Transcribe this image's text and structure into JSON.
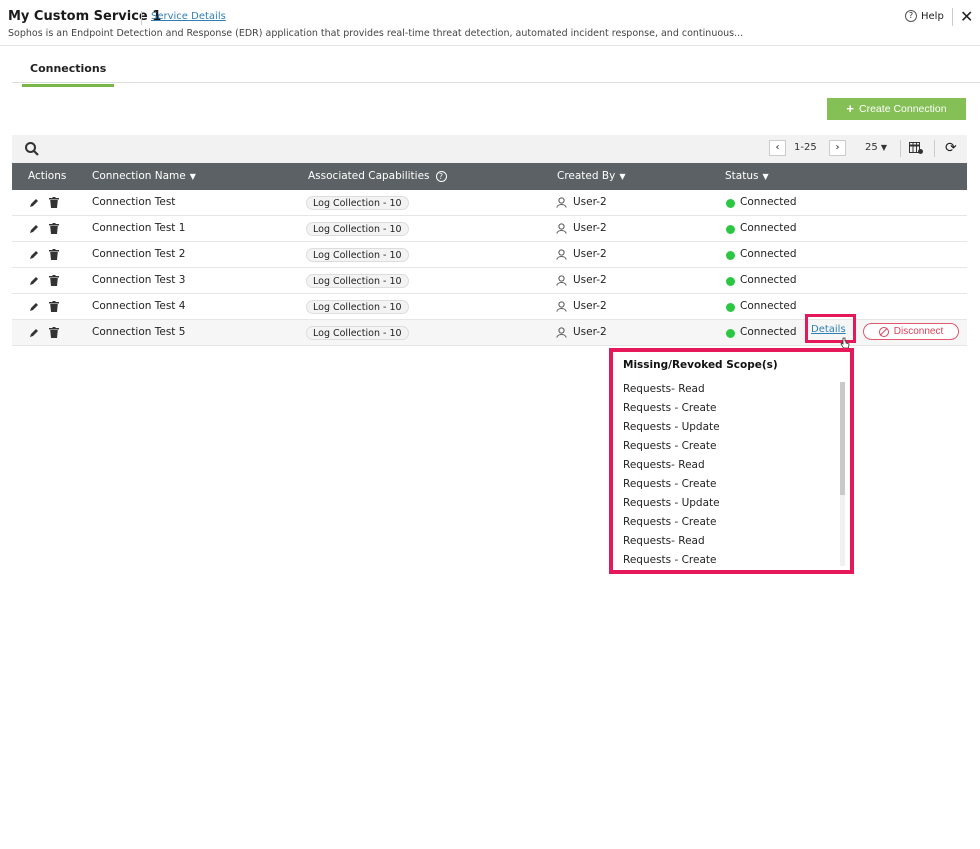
{
  "header": {
    "title": "My Custom Service 1",
    "service_link": "Service Details",
    "description": "Sophos is an Endpoint Detection and Response (EDR) application that provides real-time threat detection, automated incident response, and continuous...",
    "help_label": "Help",
    "close_glyph": "✕"
  },
  "tabs": [
    {
      "label": "Connections"
    }
  ],
  "toolbar": {
    "create_label": "Create Connection",
    "pager_range": "1-25",
    "page_size": "25",
    "prev_glyph": "‹",
    "next_glyph": "›",
    "refresh_glyph": "⟳"
  },
  "table": {
    "columns": [
      "Actions",
      "Connection Name",
      "Associated Capabilities",
      "Created By",
      "Status"
    ],
    "rows": [
      {
        "name": "Connection Test",
        "capability": "Log Collection - 10",
        "created_by": "User-2",
        "status": "Connected"
      },
      {
        "name": "Connection Test 1",
        "capability": "Log Collection - 10",
        "created_by": "User-2",
        "status": "Connected"
      },
      {
        "name": "Connection Test 2",
        "capability": "Log Collection - 10",
        "created_by": "User-2",
        "status": "Connected"
      },
      {
        "name": "Connection Test 3",
        "capability": "Log Collection - 10",
        "created_by": "User-2",
        "status": "Connected"
      },
      {
        "name": "Connection Test 4",
        "capability": "Log Collection - 10",
        "created_by": "User-2",
        "status": "Connected"
      },
      {
        "name": "Connection Test 5",
        "capability": "Log Collection - 10",
        "created_by": "User-2",
        "status": "Connected"
      }
    ],
    "row_actions": {
      "details_label": "Details",
      "disconnect_label": "Disconnect"
    }
  },
  "scope_popup": {
    "title": "Missing/Revoked Scope(s)",
    "items": [
      "Requests- Read",
      "Requests - Create",
      "Requests - Update",
      "Requests - Create",
      "Requests- Read",
      "Requests - Create",
      "Requests - Update",
      "Requests - Create",
      "Requests- Read",
      "Requests - Create"
    ]
  },
  "colors": {
    "accent_green": "#84c055",
    "status_connected": "#2bc743",
    "highlight": "#e5195a",
    "table_header": "#5b6165",
    "link": "#2f7fb5"
  }
}
